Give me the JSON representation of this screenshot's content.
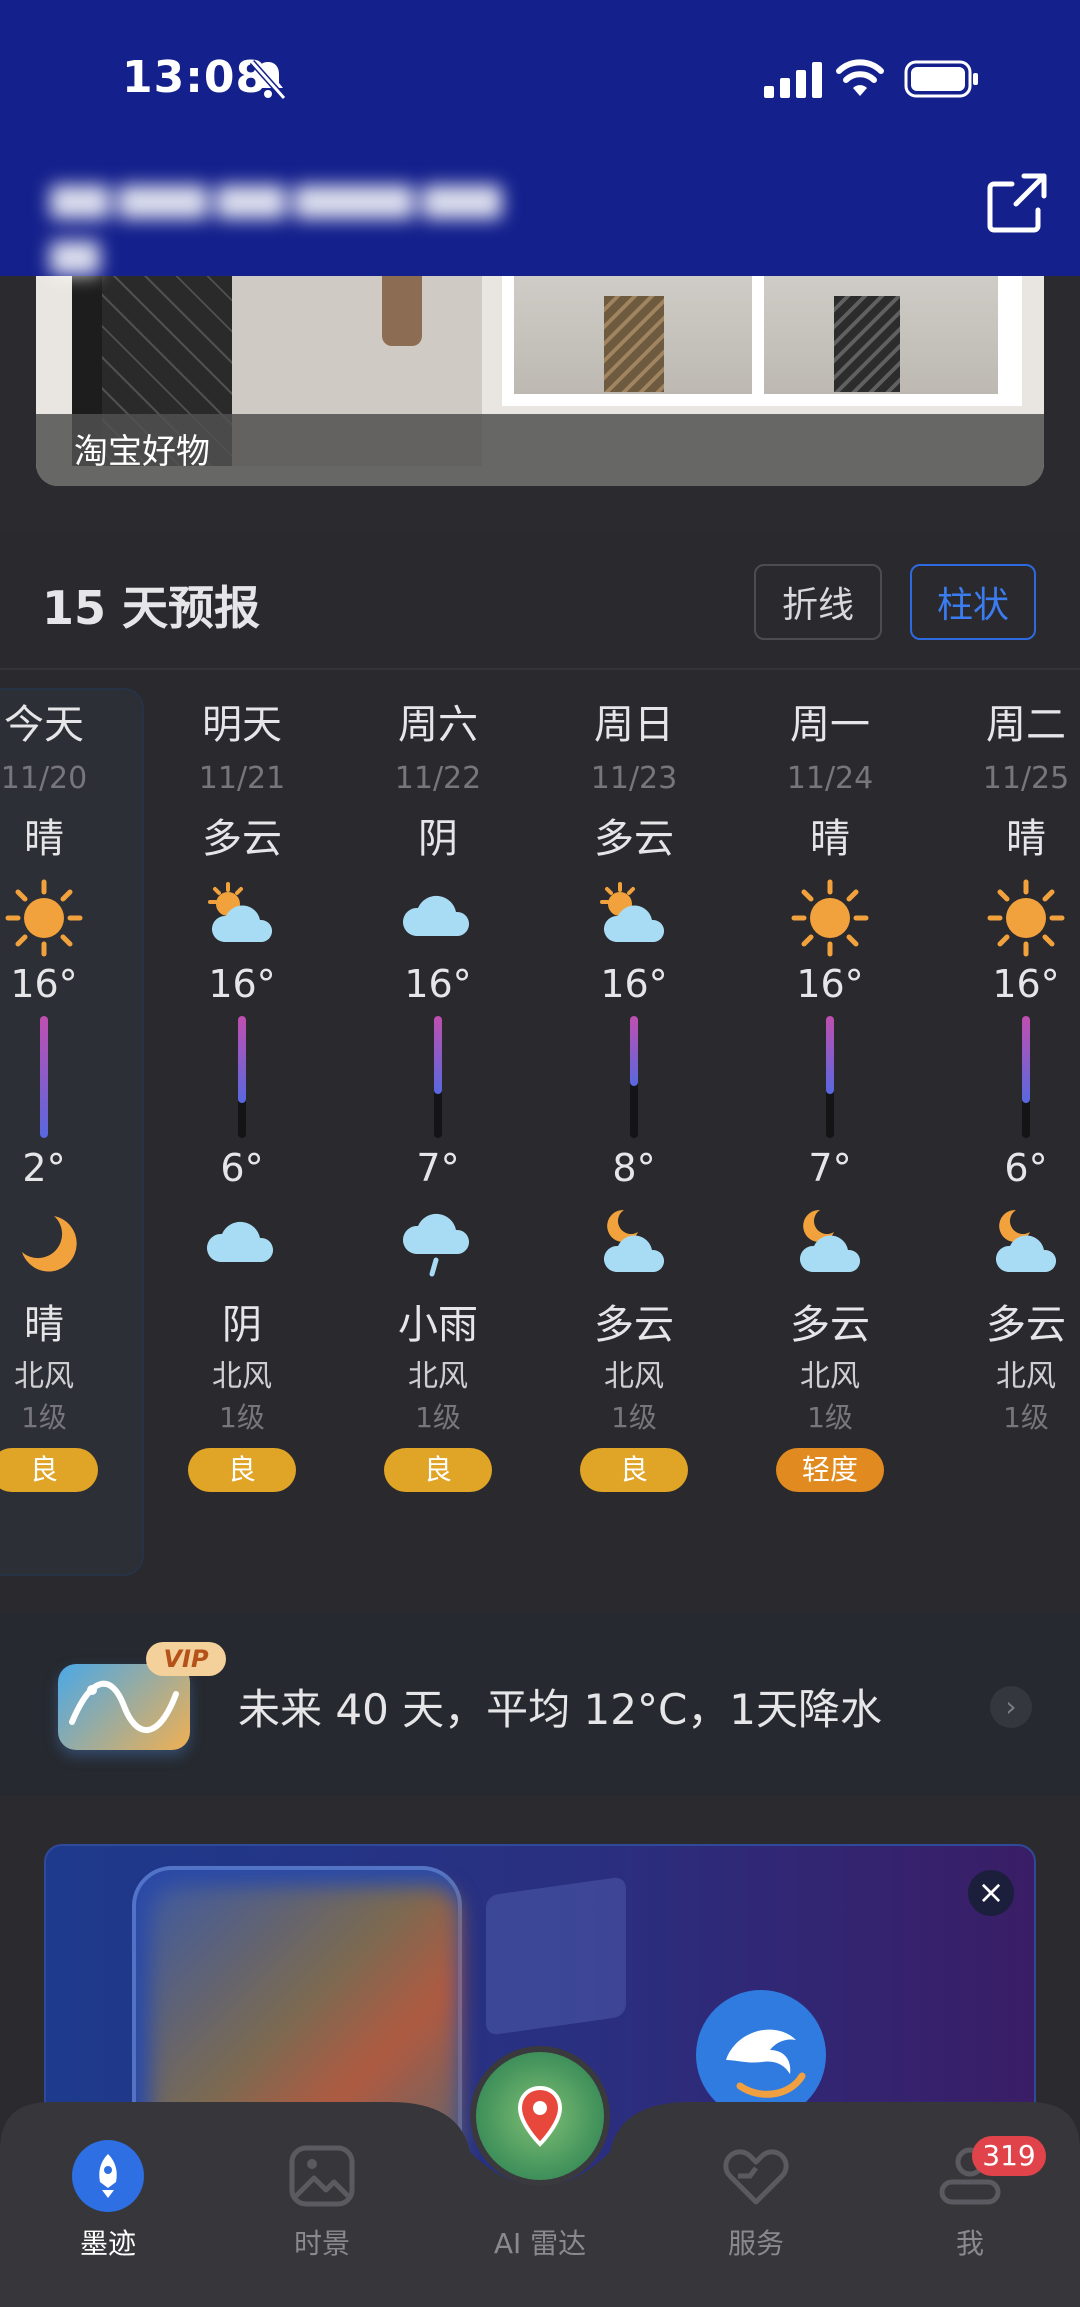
{
  "status_bar": {
    "time": "13:08"
  },
  "header": {
    "share_icon": "share-icon"
  },
  "ad_top": {
    "label": "淘宝好物"
  },
  "forecast": {
    "title": "15 天预报",
    "toggle": {
      "line_label": "折线",
      "bar_label": "柱状",
      "selected": "柱状"
    },
    "days": [
      {
        "name": "今天",
        "date": "11/20",
        "day_cond": "晴",
        "day_icon": "sun-icon",
        "high": "16°",
        "high_val": 16,
        "low": "2°",
        "low_val": 2,
        "night_icon": "moon-icon",
        "night_cond": "晴",
        "wind_dir": "北风",
        "wind_level": "1级",
        "aqi": "良"
      },
      {
        "name": "明天",
        "date": "11/21",
        "day_cond": "多云",
        "day_icon": "partly-cloudy-icon",
        "high": "16°",
        "high_val": 16,
        "low": "6°",
        "low_val": 6,
        "night_icon": "cloud-icon",
        "night_cond": "阴",
        "wind_dir": "北风",
        "wind_level": "1级",
        "aqi": "良"
      },
      {
        "name": "周六",
        "date": "11/22",
        "day_cond": "阴",
        "day_icon": "cloud-icon",
        "high": "16°",
        "high_val": 16,
        "low": "7°",
        "low_val": 7,
        "night_icon": "rain-icon",
        "night_cond": "小雨",
        "wind_dir": "北风",
        "wind_level": "1级",
        "aqi": "良"
      },
      {
        "name": "周日",
        "date": "11/23",
        "day_cond": "多云",
        "day_icon": "partly-cloudy-icon",
        "high": "16°",
        "high_val": 16,
        "low": "8°",
        "low_val": 8,
        "night_icon": "partly-cloudy-night-icon",
        "night_cond": "多云",
        "wind_dir": "北风",
        "wind_level": "1级",
        "aqi": "良"
      },
      {
        "name": "周一",
        "date": "11/24",
        "day_cond": "晴",
        "day_icon": "sun-icon",
        "high": "16°",
        "high_val": 16,
        "low": "7°",
        "low_val": 7,
        "night_icon": "partly-cloudy-night-icon",
        "night_cond": "多云",
        "wind_dir": "北风",
        "wind_level": "1级",
        "aqi": "轻度"
      },
      {
        "name": "周二",
        "date": "11/25",
        "day_cond": "晴",
        "day_icon": "sun-icon",
        "high": "16°",
        "high_val": 16,
        "low": "6°",
        "low_val": 6,
        "night_icon": "partly-cloudy-night-icon",
        "night_cond": "多云",
        "wind_dir": "北风",
        "wind_level": "1级",
        "aqi": ""
      }
    ]
  },
  "long_range": {
    "badge": "VIP",
    "text": "未来 40 天，平均 12°C，1天降水"
  },
  "tabbar": {
    "items": [
      {
        "label": "墨迹",
        "icon": "rocket-icon"
      },
      {
        "label": "时景",
        "icon": "photo-icon"
      },
      {
        "label": "AI 雷达",
        "icon": "map-pin-icon"
      },
      {
        "label": "服务",
        "icon": "heart-hands-icon"
      },
      {
        "label": "我",
        "icon": "profile-icon"
      }
    ],
    "me_badge": "319"
  }
}
